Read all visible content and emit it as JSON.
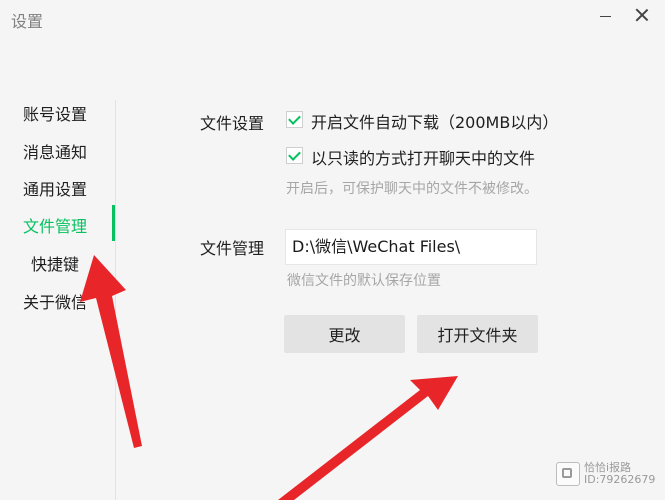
{
  "window": {
    "title": "设置"
  },
  "sidebar": {
    "items": [
      {
        "label": "账号设置"
      },
      {
        "label": "消息通知"
      },
      {
        "label": "通用设置"
      },
      {
        "label": "文件管理"
      },
      {
        "label": "快捷键"
      },
      {
        "label": "关于微信"
      }
    ],
    "active_index": 3
  },
  "file_settings": {
    "section_label": "文件设置",
    "auto_download_label": "开启文件自动下载（200MB以内）",
    "auto_download_checked": true,
    "readonly_open_label": "以只读的方式打开聊天中的文件",
    "readonly_open_checked": true,
    "readonly_hint": "开启后，可保护聊天中的文件不被修改。"
  },
  "file_management": {
    "section_label": "文件管理",
    "path_value": "D:\\微信\\WeChat Files\\",
    "path_hint": "微信文件的默认保存位置",
    "change_button": "更改",
    "open_folder_button": "打开文件夹"
  },
  "watermark": {
    "line1": "恰恰i报路",
    "line2": "ID:79262679"
  },
  "colors": {
    "accent": "#07c160",
    "annotation_arrow": "#e8262a"
  }
}
